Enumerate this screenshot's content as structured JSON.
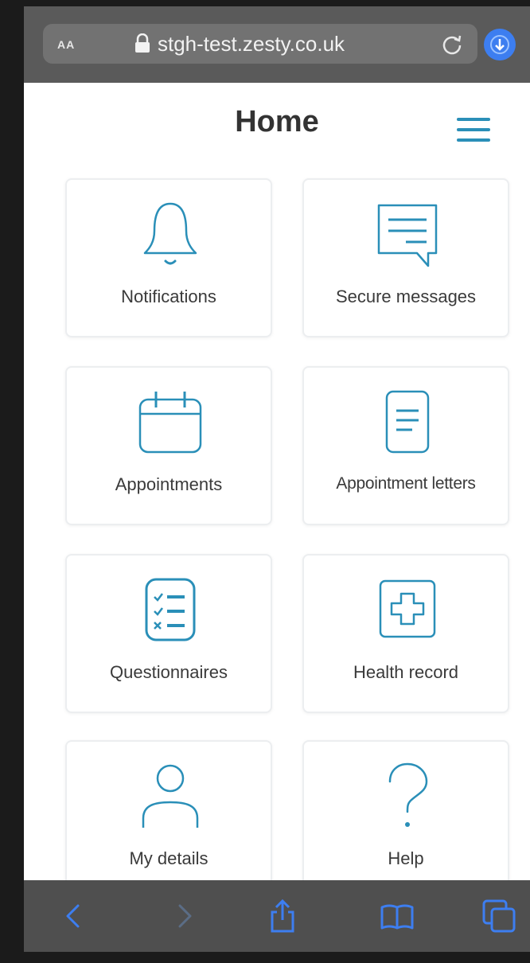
{
  "browser": {
    "text_size_label": "AA",
    "url": "stgh-test.zesty.co.uk"
  },
  "header": {
    "title": "Home"
  },
  "tiles": [
    {
      "label": "Notifications",
      "icon": "bell-icon"
    },
    {
      "label": "Secure messages",
      "icon": "message-icon"
    },
    {
      "label": "Appointments",
      "icon": "calendar-icon"
    },
    {
      "label": "Appointment letters",
      "icon": "document-icon"
    },
    {
      "label": "Questionnaires",
      "icon": "checklist-icon"
    },
    {
      "label": "Health record",
      "icon": "health-record-icon"
    },
    {
      "label": "My details",
      "icon": "user-icon"
    },
    {
      "label": "Help",
      "icon": "help-icon"
    }
  ],
  "colors": {
    "icon_stroke": "#2a8fb8",
    "browser_chrome": "#5a5a5a",
    "toolbar_icon": "#3d7ef0"
  }
}
